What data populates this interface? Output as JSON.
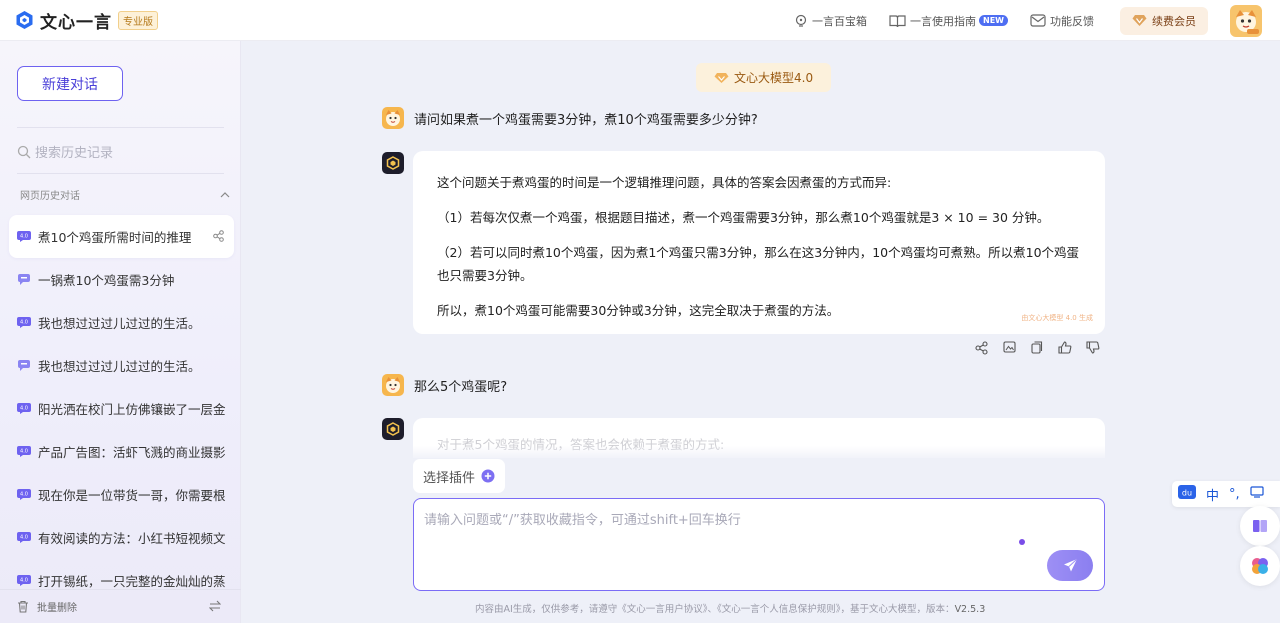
{
  "header": {
    "app_name": "文心一言",
    "badge": "专业版",
    "links": [
      {
        "label": "一言百宝箱",
        "icon": "lightbulb-icon"
      },
      {
        "label": "一言使用指南",
        "icon": "book-icon",
        "badge": "NEW"
      },
      {
        "label": "功能反馈",
        "icon": "mail-icon"
      }
    ],
    "renew_label": "续费会员"
  },
  "sidebar": {
    "new_chat": "新建对话",
    "search_placeholder": "搜索历史记录",
    "section_title": "网页历史对话",
    "items": [
      {
        "label": "煮10个鸡蛋所需时间的推理"
      },
      {
        "label": "一锅煮10个鸡蛋需3分钟"
      },
      {
        "label": "我也想过过过儿过过的生活。"
      },
      {
        "label": "我也想过过过儿过过的生活。"
      },
      {
        "label": "阳光洒在校门上仿佛镶嵌了一层金"
      },
      {
        "label": "产品广告图：活虾飞溅的商业摄影"
      },
      {
        "label": "现在你是一位带货一哥，你需要根"
      },
      {
        "label": "有效阅读的方法：小红书短视频文"
      },
      {
        "label": "打开锡纸，一只完整的金灿灿的蒸"
      }
    ],
    "batch_delete": "批量删除"
  },
  "chat": {
    "model_label": "文心大模型4.0",
    "q1": "请问如果煮一个鸡蛋需要3分钟，煮10个鸡蛋需要多少分钟?",
    "a1": [
      "这个问题关于煮鸡蛋的时间是一个逻辑推理问题，具体的答案会因煮蛋的方式而异:",
      "（1）若每次仅煮一个鸡蛋，根据题目描述，煮一个鸡蛋需要3分钟，那么煮10个鸡蛋就是3 × 10 = 30 分钟。",
      "（2）若可以同时煮10个鸡蛋，因为煮1个鸡蛋只需3分钟，那么在这3分钟内，10个鸡蛋均可煮熟。所以煮10个鸡蛋也只需要3分钟。",
      "所以，煮10个鸡蛋可能需要30分钟或3分钟，这完全取决于煮蛋的方法。"
    ],
    "a1_note": "由文心大模型 4.0 生成",
    "q2": "那么5个鸡蛋呢?",
    "a2_preview": "对于煮5个鸡蛋的情况，答案也会依赖于煮蛋的方式:"
  },
  "composer": {
    "plugin_label": "选择插件",
    "placeholder": "请输入问题或“/”获取收藏指令，可通过shift+回车换行"
  },
  "footer": {
    "text": "内容由AI生成，仅供参考，请遵守《文心一言用户协议》、《文心一言个人信息保护规则》，基于文心大模型，版本：",
    "version": "V2.5.3"
  },
  "float": {
    "ime_char": "中"
  },
  "colors": {
    "accent": "#6e62f0",
    "warm": "#9a5a12"
  }
}
